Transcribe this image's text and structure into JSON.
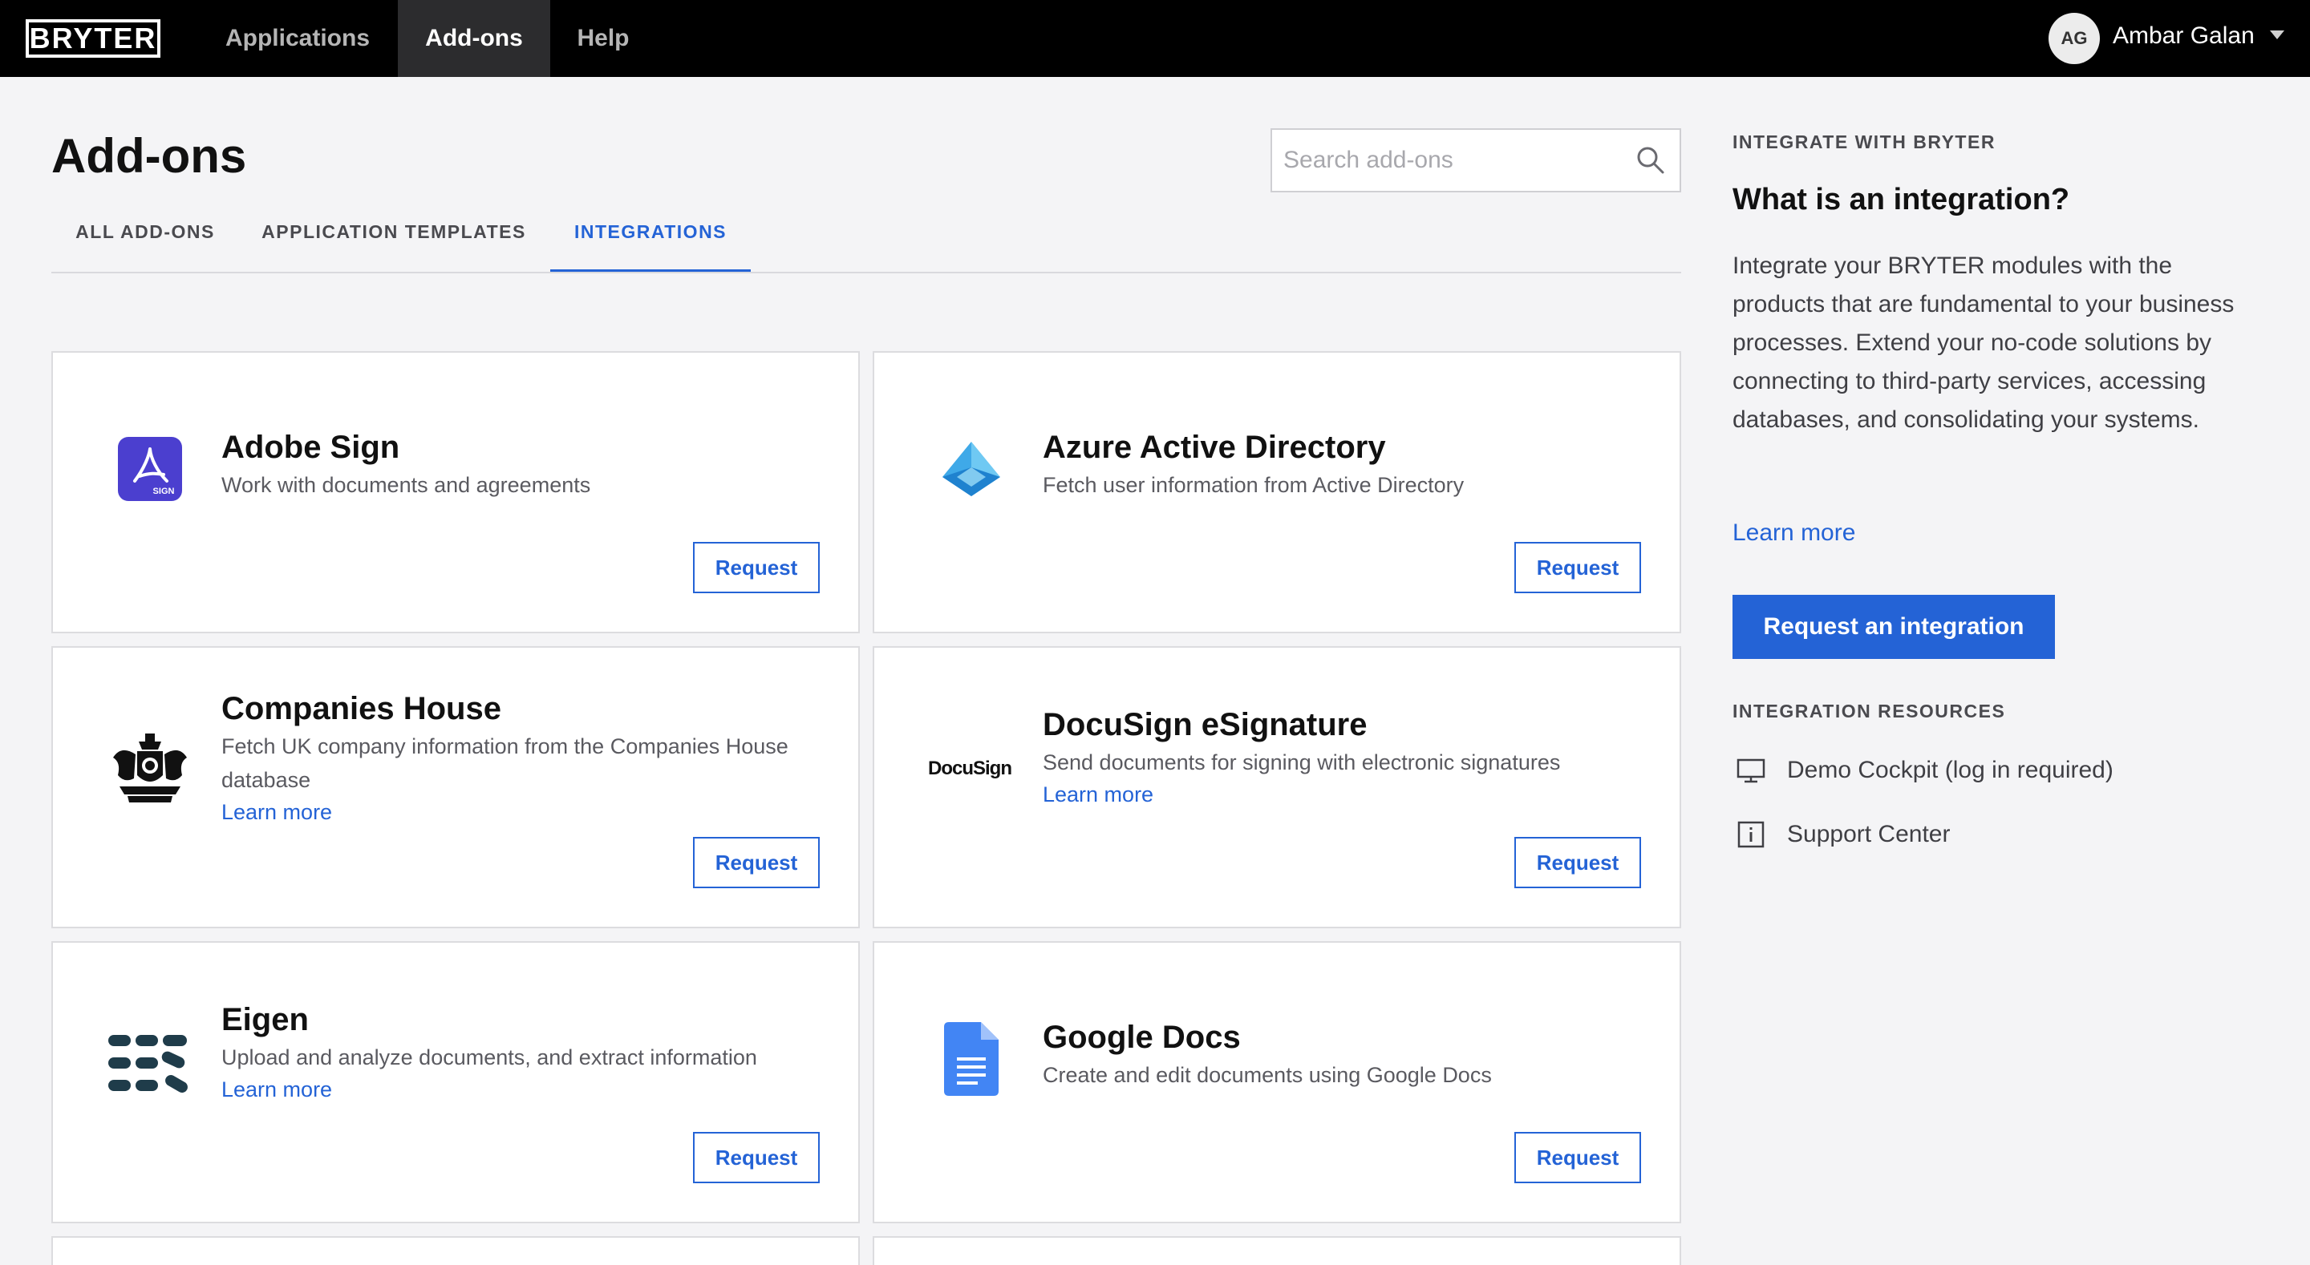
{
  "topbar": {
    "logo": "BRYTER",
    "nav": [
      "Applications",
      "Add-ons",
      "Help"
    ],
    "active_nav": "Add-ons",
    "user_initials": "AG",
    "user_name": "Ambar Galan"
  },
  "page": {
    "title": "Add-ons",
    "search_placeholder": "Search add-ons",
    "tabs": [
      "ALL ADD-ONS",
      "APPLICATION TEMPLATES",
      "INTEGRATIONS"
    ],
    "active_tab": "INTEGRATIONS"
  },
  "cards": [
    {
      "title": "Adobe Sign",
      "description": "Work with documents and agreements",
      "link": "",
      "button": "Request",
      "icon": "adobe-sign-icon"
    },
    {
      "title": "Azure Active Directory",
      "description": "Fetch user information from Active Directory",
      "link": "",
      "button": "Request",
      "icon": "azure-pyramid-icon"
    },
    {
      "title": "Companies House",
      "description": "Fetch UK company information from the Companies House database",
      "link": "Learn more",
      "button": "Request",
      "icon": "royal-crest-icon"
    },
    {
      "title": "DocuSign eSignature",
      "description": "Send documents for signing with electronic signatures",
      "link": "Learn more",
      "button": "Request",
      "icon": "docusign-wordmark",
      "wordmark": "DocuSign"
    },
    {
      "title": "Eigen",
      "description": "Upload and analyze documents, and extract information",
      "link": "Learn more",
      "button": "Request",
      "icon": "eigen-bars-icon"
    },
    {
      "title": "Google Docs",
      "description": "Create and edit documents using Google Docs",
      "link": "",
      "button": "Request",
      "icon": "google-docs-icon"
    }
  ],
  "sidebar": {
    "kicker": "INTEGRATE WITH BRYTER",
    "title": "What is an integration?",
    "body": "Integrate your BRYTER modules with the products that are fundamental to your business processes. Extend your no-code solutions by connecting to third-party services, accessing databases, and consolidating your systems.",
    "learn_more": "Learn more",
    "cta": "Request an integration",
    "resources_heading": "INTEGRATION RESOURCES",
    "resources": [
      {
        "label": "Demo Cockpit (log in required)",
        "icon": "monitor-icon"
      },
      {
        "label": "Support Center",
        "icon": "info-icon"
      }
    ]
  },
  "colors": {
    "accent": "#2463d6",
    "topbar": "#000000",
    "nav_active_bg": "#2c2c2e",
    "background": "#f4f4f6"
  }
}
